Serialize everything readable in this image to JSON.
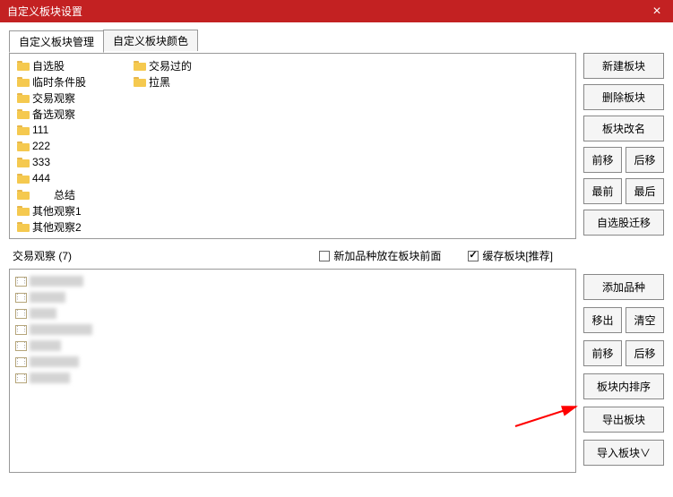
{
  "window": {
    "title": "自定义板块设置"
  },
  "tabs": [
    {
      "label": "自定义板块管理"
    },
    {
      "label": "自定义板块颜色"
    }
  ],
  "folders_col1": [
    "自选股",
    "临时条件股",
    "交易观察",
    "备选观察",
    "111",
    "222",
    "333",
    "444",
    "　　总结",
    "其他观察1",
    "其他观察2"
  ],
  "folders_col2": [
    "交易过的",
    "拉黑"
  ],
  "upper_buttons": {
    "new": "新建板块",
    "delete": "删除板块",
    "rename": "板块改名",
    "forward": "前移",
    "backward": "后移",
    "first": "最前",
    "last": "最后",
    "migrate": "自选股迁移"
  },
  "mid": {
    "current_label": "交易观察 (7)",
    "checkbox1_label": "新加品种放在板块前面",
    "checkbox1_checked": false,
    "checkbox2_label": "缓存板块[推荐]",
    "checkbox2_checked": true
  },
  "items": [
    {
      "w": 60
    },
    {
      "w": 40
    },
    {
      "w": 30
    },
    {
      "w": 70
    },
    {
      "w": 35
    },
    {
      "w": 55
    },
    {
      "w": 45
    }
  ],
  "lower_buttons": {
    "add": "添加品种",
    "move_out": "移出",
    "clear": "清空",
    "forward": "前移",
    "backward": "后移",
    "sort_in": "板块内排序",
    "export": "导出板块",
    "import": "导入板块∨"
  }
}
